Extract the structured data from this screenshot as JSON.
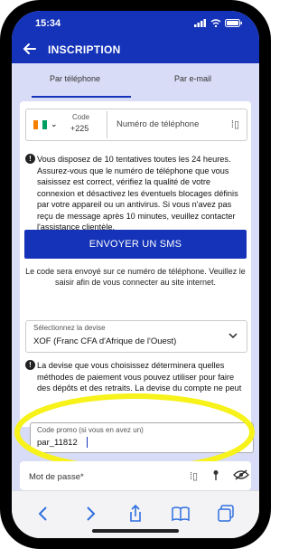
{
  "status_bar": {
    "time": "15:34"
  },
  "header": {
    "title": "INSCRIPTION",
    "icon": "back-arrow-icon"
  },
  "tabs": [
    {
      "label": "Par téléphone",
      "active": true
    },
    {
      "label": "Par e-mail",
      "active": false
    }
  ],
  "phone_field": {
    "code_label": "Code",
    "code_value": "+225",
    "placeholder": "Numéro de téléphone"
  },
  "phone_info": "Vous disposez de 10 tentatives toutes les 24 heures. Assurez-vous que le numéro de téléphone que vous saisissez est correct, vérifiez la qualité de votre connexion et désactivez les éventuels blocages définis par votre appareil ou un antivirus. Si vous n'avez pas reçu de message après 10 minutes, veuillez contacter l'assistance clientèle.",
  "sms_button": "ENVOYER UN SMS",
  "sms_note": "Le code sera envoyé sur ce numéro de téléphone. Veuillez le saisir afin de vous connecter au site internet.",
  "currency": {
    "label": "Sélectionnez la devise",
    "value": "XOF  (Franc CFA d'Afrique de l'Ouest)",
    "info": "La devise que vous choisissez déterminera quelles méthodes de paiement vous pouvez utiliser pour faire des dépôts et des retraits. La devise du compte ne peut pas être modifiée après l'inscription."
  },
  "promo": {
    "label": "Code promo (si vous en avez un)",
    "value": "par_11812"
  },
  "password": {
    "label": "Mot de passe*"
  },
  "colors": {
    "brand": "#1433b8",
    "background": "#d9dcf6",
    "highlight": "#f6f21a"
  }
}
